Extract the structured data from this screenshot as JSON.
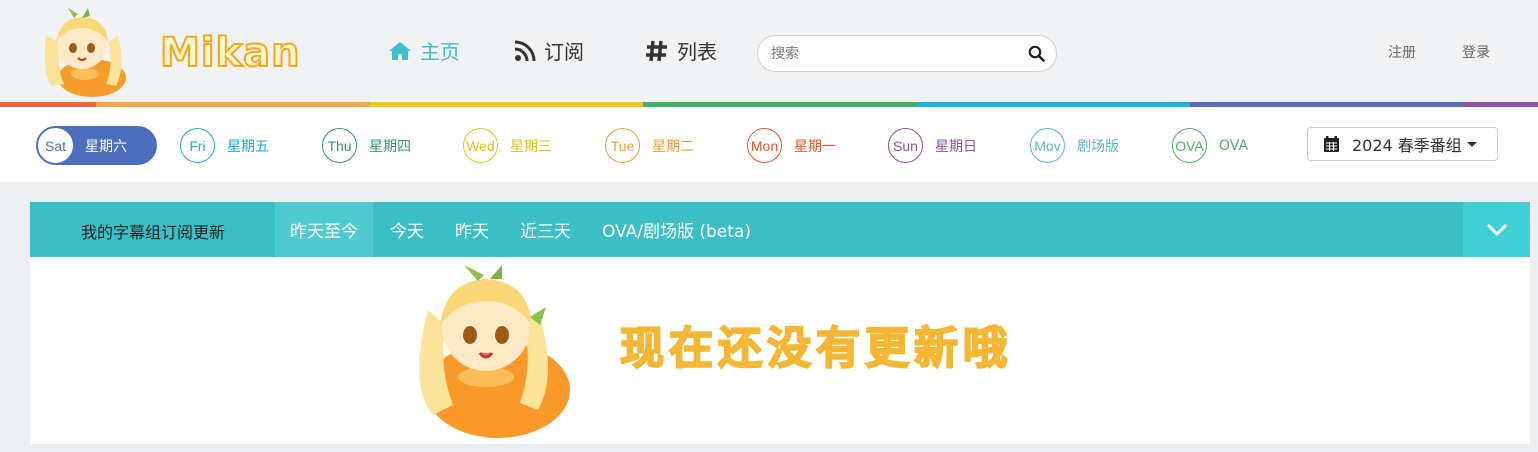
{
  "brand": {
    "name": "Mikan"
  },
  "nav": [
    {
      "label": "主页",
      "icon": "home-icon",
      "active": true
    },
    {
      "label": "订阅",
      "icon": "rss-icon",
      "active": false
    },
    {
      "label": "列表",
      "icon": "hashtag-icon",
      "active": false
    }
  ],
  "search": {
    "placeholder": "搜索",
    "value": ""
  },
  "auth": {
    "register": "注册",
    "login": "登录"
  },
  "rainbow_colors": [
    "#f0653b",
    "#f5a54a",
    "#e9c81a",
    "#41b06a",
    "#19b4e6",
    "#5b6db8",
    "#8e52a7"
  ],
  "days": [
    {
      "abbr": "Sat",
      "label": "星期六",
      "color": "#4d6ebd",
      "active": true
    },
    {
      "abbr": "Fri",
      "label": "星期五",
      "color": "#19a8d9"
    },
    {
      "abbr": "Thu",
      "label": "星期四",
      "color": "#2f9e5c"
    },
    {
      "abbr": "Wed",
      "label": "星期三",
      "color": "#e2c21b"
    },
    {
      "abbr": "Tue",
      "label": "星期二",
      "color": "#f39a3c"
    },
    {
      "abbr": "Mon",
      "label": "星期一",
      "color": "#e8572c"
    },
    {
      "abbr": "Sun",
      "label": "星期日",
      "color": "#8a4fa3"
    },
    {
      "abbr": "Mov",
      "label": "剧场版",
      "color": "#5ab4c8"
    },
    {
      "abbr": "OVA",
      "label": "OVA",
      "color": "#4caf6a"
    }
  ],
  "season": {
    "label": "2024 春季番组"
  },
  "updates": {
    "title": "我的字幕组订阅更新",
    "tabs": [
      "昨天至今",
      "今天",
      "昨天",
      "近三天",
      "OVA/剧场版 (beta)"
    ],
    "active_tab": "昨天至今",
    "empty_message": "现在还没有更新哦"
  }
}
